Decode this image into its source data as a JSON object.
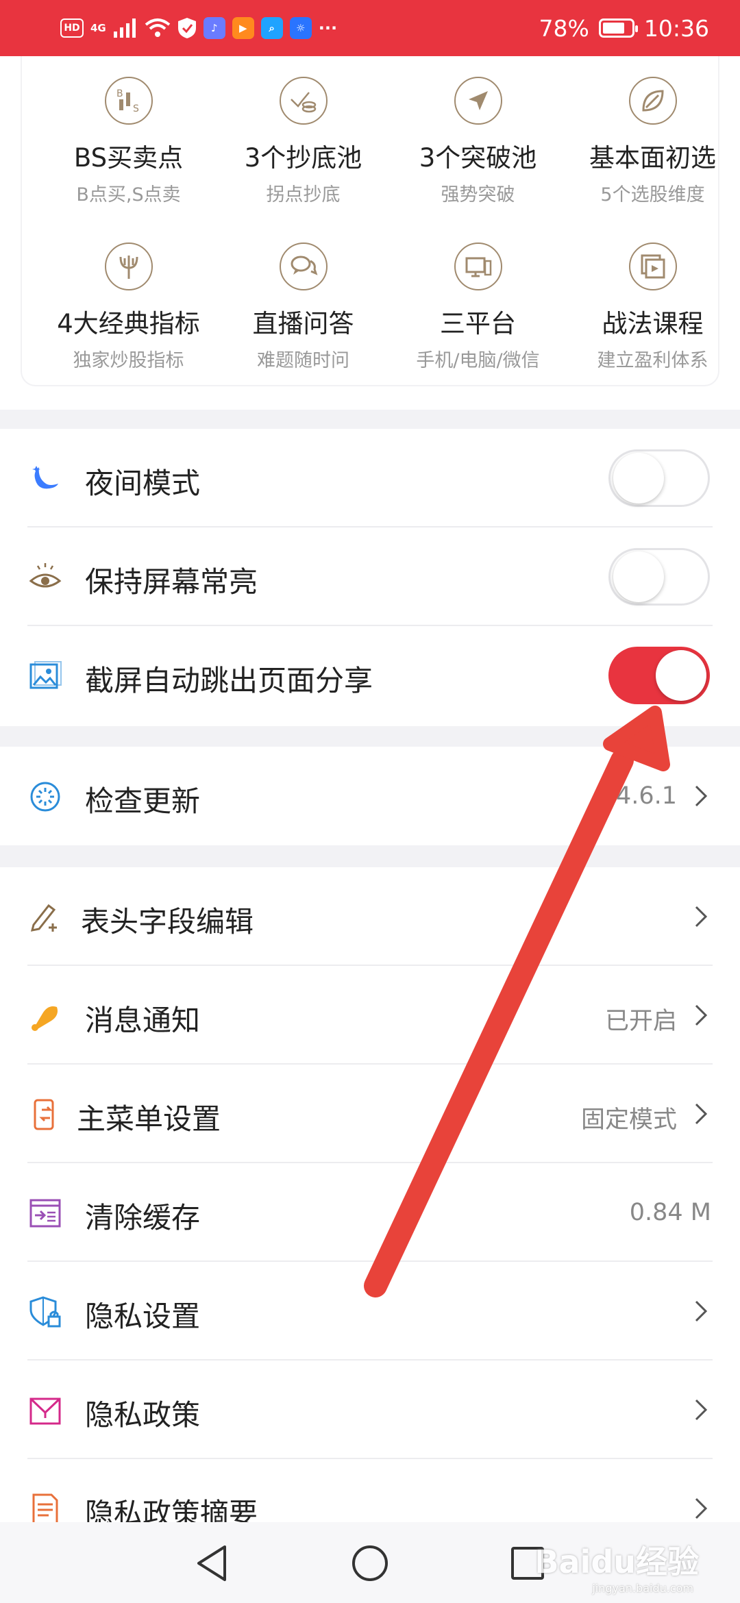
{
  "status_bar": {
    "hd": "HD",
    "network": "4G",
    "battery": "78%",
    "battery_level": 0.78,
    "time": "10:36",
    "more": "···"
  },
  "features": [
    {
      "title": "BS买卖点",
      "sub": "B点买,S点卖",
      "icon": "candlestick-bs-icon"
    },
    {
      "title": "3个抄底池",
      "sub": "拐点抄底",
      "icon": "coins-chart-icon"
    },
    {
      "title": "3个突破池",
      "sub": "强势突破",
      "icon": "navigation-arrow-icon"
    },
    {
      "title": "基本面初选",
      "sub": "5个选股维度",
      "icon": "leaf-icon"
    },
    {
      "title": "4大经典指标",
      "sub": "独家炒股指标",
      "icon": "trident-icon"
    },
    {
      "title": "直播问答",
      "sub": "难题随时问",
      "icon": "chat-bubbles-icon"
    },
    {
      "title": "三平台",
      "sub": "手机/电脑/微信",
      "icon": "devices-icon"
    },
    {
      "title": "战法课程",
      "sub": "建立盈利体系",
      "icon": "video-course-icon"
    }
  ],
  "settings": {
    "night_mode": {
      "label": "夜间模式",
      "on": false
    },
    "keep_screen_on": {
      "label": "保持屏幕常亮",
      "on": false
    },
    "screenshot_share": {
      "label": "截屏自动跳出页面分享",
      "on": true
    },
    "check_update": {
      "label": "检查更新",
      "value": "V4.6.1"
    },
    "header_fields": {
      "label": "表头字段编辑"
    },
    "notifications": {
      "label": "消息通知",
      "value": "已开启"
    },
    "main_menu": {
      "label": "主菜单设置",
      "value": "固定模式"
    },
    "clear_cache": {
      "label": "清除缓存",
      "value": "0.84 M"
    },
    "privacy_settings": {
      "label": "隐私设置"
    },
    "privacy_policy": {
      "label": "隐私政策"
    },
    "privacy_summary": {
      "label": "隐私政策摘要"
    }
  },
  "watermark": {
    "brand": "Baidu经验",
    "url": "jingyan.baidu.com"
  },
  "colors": {
    "accent": "#e8343f",
    "icon_gold": "#a08a6e"
  }
}
